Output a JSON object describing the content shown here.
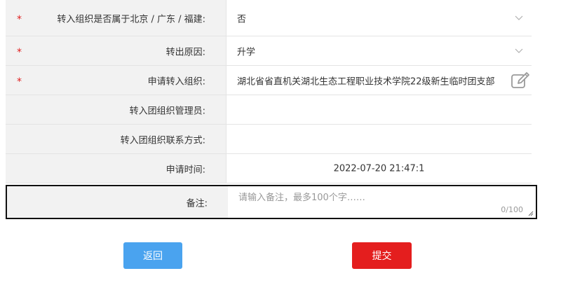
{
  "form": {
    "rows": [
      {
        "label": "转入组织是否属于北京 / 广东 / 福建:",
        "value": "否",
        "required": true,
        "control": "select"
      },
      {
        "label": "转出原因:",
        "value": "升学",
        "required": true,
        "control": "select"
      },
      {
        "label": "申请转入组织:",
        "value": "湖北省省直机关湖北生态工程职业技术学院22级新生临时团支部",
        "required": true,
        "control": "edit"
      },
      {
        "label": "转入团组织管理员:",
        "value": "",
        "required": false
      },
      {
        "label": "转入团组织联系方式:",
        "value": "",
        "required": false
      },
      {
        "label": "申请时间:",
        "value": "2022-07-20 21:47:1",
        "required": false
      }
    ],
    "required_mark": "*",
    "remark": {
      "label": "备注:",
      "placeholder": "请输入备注，最多100个字……",
      "value": "",
      "counter": "0/100"
    }
  },
  "buttons": {
    "back": "返回",
    "submit": "提交"
  },
  "icons": {
    "select_arrow": "chevron-down-icon",
    "edit": "edit-icon",
    "resize": "resize-handle-icon"
  },
  "colors": {
    "required": "#e02020",
    "back_button": "#4aa3ef",
    "submit_button": "#e41e1e",
    "label_background": "#f2f2f2"
  }
}
